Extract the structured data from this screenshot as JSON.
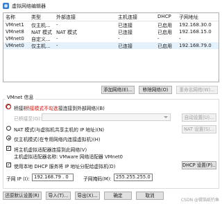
{
  "window": {
    "title": "虚拟网络编辑器"
  },
  "table": {
    "headers": [
      "名称",
      "类型",
      "外部连接",
      "主机连接",
      "DHCP",
      "子网地址"
    ],
    "rows": [
      [
        "VMnet1",
        "仅主机...",
        "-",
        "已连接",
        "已启用",
        "192.168.30.0"
      ],
      [
        "VMnet8",
        "NAT 模式",
        "NAT 模式",
        "已连接",
        "已启用",
        "192.168.15.0"
      ],
      [
        "VMnet0",
        "自定义...",
        "-",
        "-",
        "-",
        "-"
      ],
      [
        "VMnet0",
        "仅主机...",
        "-",
        "已连接",
        "已启用",
        "192.168.79.0"
      ]
    ],
    "selected_row": 3
  },
  "net_buttons": {
    "add": "添加网络(E)...",
    "remove": "移除网络(O)",
    "rename": "重命名网络(W)..."
  },
  "vmnet": {
    "group_title": "VMnet 信息",
    "bridge_label": "桥接模式(将虚拟机直接连接到外部网络)(B)",
    "bridged_to_label": "已桥接至(G):",
    "auto_settings": "自动设置(U)...",
    "nat_label": "NAT 模式(与虚拟机共享主机的 IP 地址)(N)",
    "nat_settings": "NAT 设置(S)...",
    "hostonly_label": "仅主机模式(在专用网络内连接虚拟机)(H)",
    "connect_adapter_label": "将主机虚拟适配器连接到此网络(V)",
    "adapter_name_label": "主机虚拟适配器名称: VMware 网络适配器 VMnet0",
    "dhcp_label": "使用本地 DHCP 服务将 IP 地址分配给虚拟机(D)",
    "dhcp_settings": "DHCP 设置(P)...",
    "subnet_ip_label": "子网 IP (I):",
    "subnet_ip_value": "192.168.79 . 0",
    "subnet_mask_label": "子网掩码(M):",
    "subnet_mask_value": "255.255.255.0"
  },
  "annotation": {
    "text": "桥接模式不勾选"
  },
  "footer": {
    "restore": "还原默认设置(R)",
    "import": "导入(T)...",
    "export": "导出(X)...",
    "ok": "确定",
    "cancel": "取消"
  },
  "watermark": "CSDN @锡箔纸钓鱼",
  "colors": {
    "annotation": "#d9231d",
    "selection": "#e5f1fb",
    "accent": "#3b7fd0"
  }
}
